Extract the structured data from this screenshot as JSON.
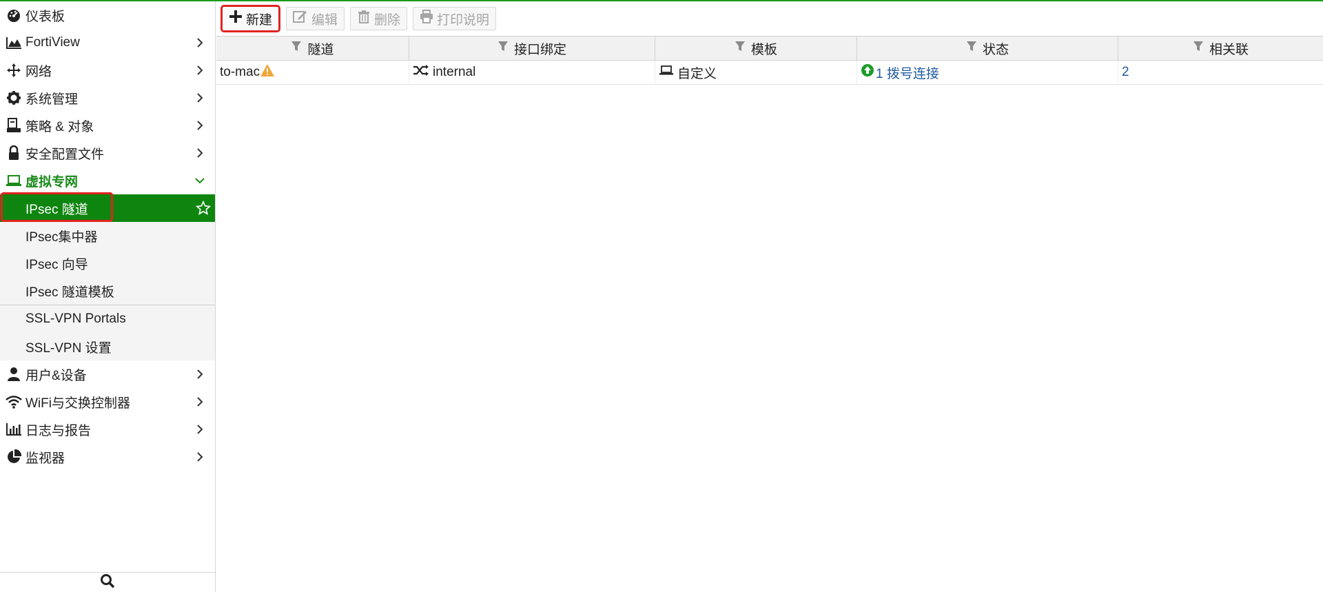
{
  "sidebar": {
    "items": [
      {
        "label": "仪表板",
        "icon": "dashboard-icon",
        "chevron": false
      },
      {
        "label": "FortiView",
        "icon": "area-chart-icon",
        "chevron": true
      },
      {
        "label": "网络",
        "icon": "arrows-move-icon",
        "chevron": true
      },
      {
        "label": "系统管理",
        "icon": "gear-icon",
        "chevron": true
      },
      {
        "label": "策略 & 对象",
        "icon": "policy-icon",
        "chevron": true
      },
      {
        "label": "安全配置文件",
        "icon": "lock-icon",
        "chevron": true
      },
      {
        "label": "虚拟专网",
        "icon": "laptop-icon",
        "chevron": true,
        "expanded": true
      }
    ],
    "vpn_subitems": [
      {
        "label": "IPsec 隧道",
        "active": true
      },
      {
        "label": "IPsec集中器"
      },
      {
        "label": "IPsec 向导"
      },
      {
        "label": "IPsec 隧道模板"
      },
      {
        "label": "SSL-VPN Portals"
      },
      {
        "label": "SSL-VPN 设置"
      }
    ],
    "items_after": [
      {
        "label": "用户&设备",
        "icon": "user-icon"
      },
      {
        "label": "WiFi与交换控制器",
        "icon": "wifi-icon"
      },
      {
        "label": "日志与报告",
        "icon": "bar-chart-icon"
      },
      {
        "label": "监视器",
        "icon": "pie-chart-icon"
      }
    ]
  },
  "toolbar": {
    "new_label": "新建",
    "edit_label": "编辑",
    "delete_label": "删除",
    "print_label": "打印说明"
  },
  "table": {
    "headers": [
      "隧道",
      "接口绑定",
      "模板",
      "状态",
      "相关联"
    ],
    "rows": [
      {
        "tunnel": "to-mac",
        "interface": "internal",
        "template": "自定义",
        "status": "1 拨号连接",
        "ref": "2"
      }
    ]
  },
  "colors": {
    "accent": "#0e850e",
    "highlight": "#e0231f",
    "link": "#1f5ba0"
  }
}
